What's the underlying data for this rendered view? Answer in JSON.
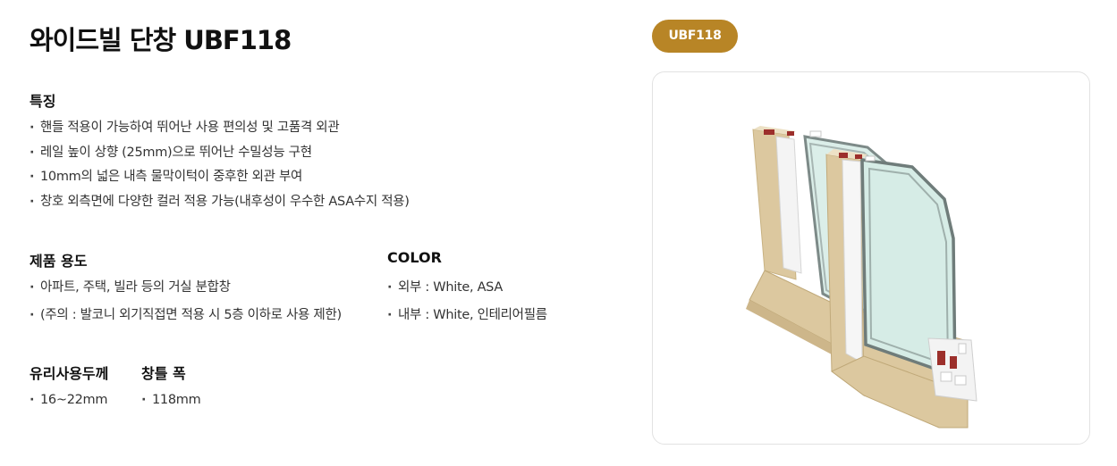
{
  "title": "와이드빌 단창 UBF118",
  "features": {
    "heading": "특징",
    "items": [
      "핸들 적용이 가능하여 뛰어난 사용 편의성 및 고품격 외관",
      "레일 높이 상향 (25mm)으로 뛰어난 수밀성능 구현",
      "10mm의 넓은 내측 물막이턱이 중후한 외관 부여",
      "창호 외측면에 다양한 컬러 적용 가능(내후성이 우수한 ASA수지 적용)"
    ]
  },
  "usage": {
    "heading": "제품 용도",
    "items": [
      "아파트, 주택, 빌라 등의 거실 분합창",
      "(주의 : 발코니 외기직접면 적용 시 5층 이하로 사용 제한)"
    ]
  },
  "color": {
    "heading": "COLOR",
    "items": [
      "외부 : White, ASA",
      "내부 : White, 인테리어필름"
    ]
  },
  "glass_thickness": {
    "heading": "유리사용두께",
    "items": [
      "16~22mm"
    ]
  },
  "window_width": {
    "heading": "창틀 폭",
    "items": [
      "118mm"
    ]
  },
  "model_badge": "UBF118",
  "colors": {
    "accent": "#b88526",
    "frame_wood": "#dcc89f",
    "frame_white": "#f2f2f2",
    "glass": "#dbeee9",
    "seal_red": "#9c2f2b"
  }
}
